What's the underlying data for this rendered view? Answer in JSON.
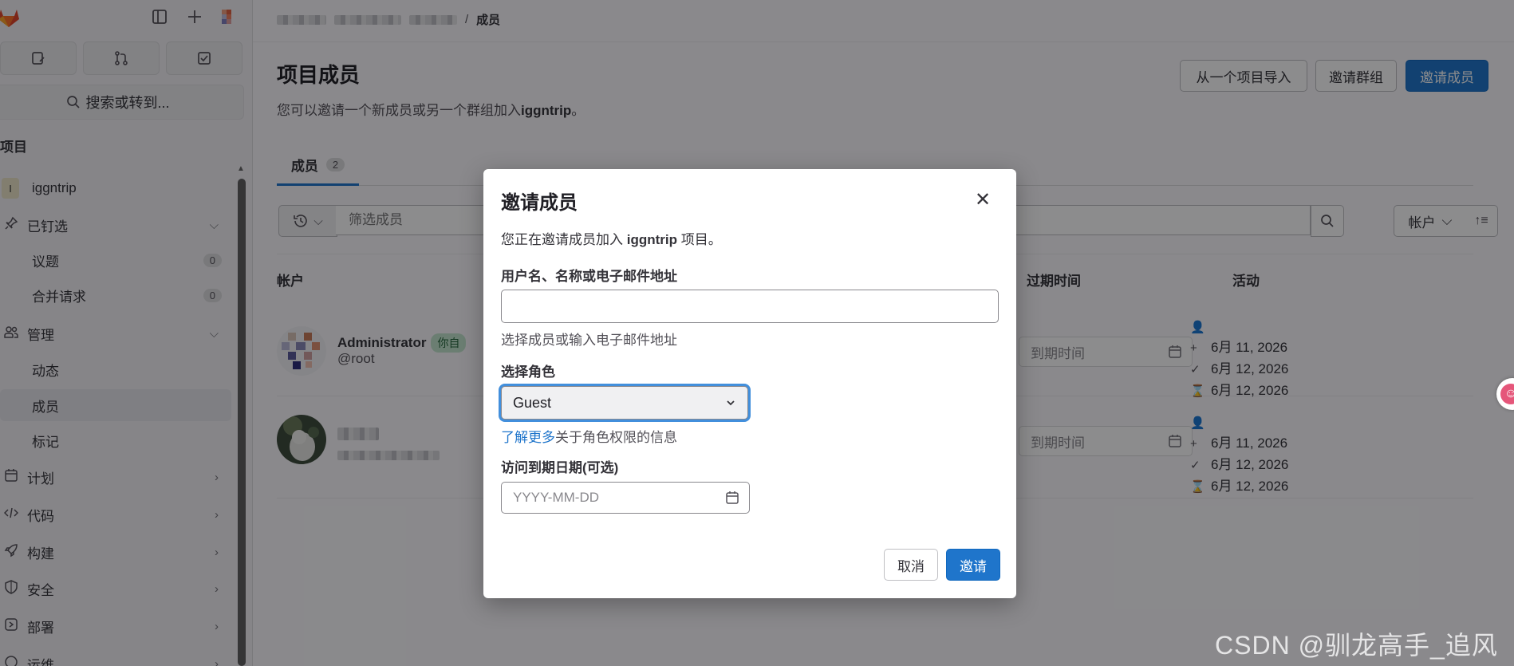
{
  "sidebar": {
    "search_label": "搜索或转到...",
    "heading": "项目",
    "project_initial": "I",
    "project_name": "iggntrip",
    "items": {
      "pinned": "已钉选",
      "issues": "议题",
      "issues_count": "0",
      "merge_requests": "合并请求",
      "merge_requests_count": "0",
      "manage": "管理",
      "activity": "动态",
      "members": "成员",
      "labels": "标记",
      "plan": "计划",
      "code": "代码",
      "build": "构建",
      "secure": "安全",
      "deploy": "部署",
      "operate": "运维"
    }
  },
  "breadcrumb": {
    "separator": "/",
    "current": "成员"
  },
  "header": {
    "title": "项目成员",
    "desc_prefix": "您可以邀请一个新成员或另一个群组加入",
    "desc_project": "iggntrip",
    "desc_suffix": "。",
    "import_button": "从一个项目导入",
    "invite_group_button": "邀请群组",
    "invite_members_button": "邀请成员"
  },
  "tabs": [
    {
      "label": "成员",
      "count": "2"
    }
  ],
  "filter": {
    "placeholder": "筛选成员",
    "sort_label": "帐户"
  },
  "table": {
    "headers": {
      "account": "帐户",
      "expiry": "过期时间",
      "activity": "活动"
    },
    "rows": [
      {
        "name": "Administrator",
        "badge": "你自",
        "handle": "@root",
        "expiry_placeholder": "到期时间",
        "activity": [
          "6月 11, 2026",
          "6月 12, 2026",
          "6月 12, 2026"
        ]
      },
      {
        "name": "",
        "handle": "",
        "expiry_placeholder": "到期时间",
        "activity": [
          "6月 11, 2026",
          "6月 12, 2026",
          "6月 12, 2026"
        ]
      }
    ]
  },
  "modal": {
    "title": "邀请成员",
    "intro_prefix": "您正在邀请成员加入 ",
    "intro_project": "iggntrip",
    "intro_suffix": " 项目。",
    "username_label": "用户名、名称或电子邮件地址",
    "username_value": "",
    "username_help": "选择成员或输入电子邮件地址",
    "role_label": "选择角色",
    "role_value": "Guest",
    "learn_more_link": "了解更多",
    "learn_more_suffix": "关于角色权限的信息",
    "expiry_label": "访问到期日期(可选)",
    "expiry_placeholder": "YYYY-MM-DD",
    "cancel_button": "取消",
    "invite_button": "邀请"
  },
  "watermark": "CSDN @驯龙高手_追风",
  "colors": {
    "primary": "#1f75cb",
    "focus_ring": "#428fdc",
    "overlay": "rgba(5,5,6,0.46)"
  }
}
